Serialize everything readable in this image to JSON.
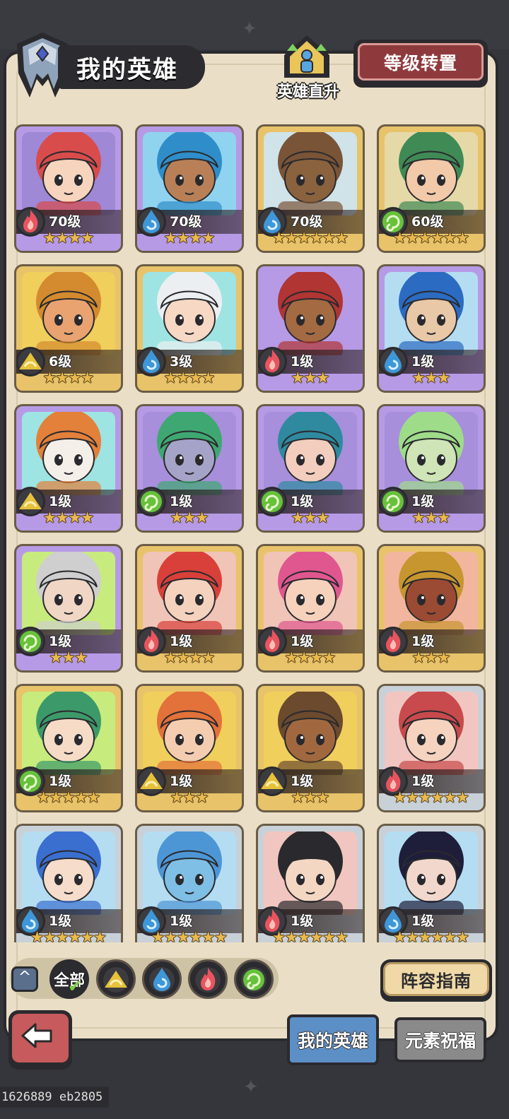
{
  "header": {
    "title": "我的英雄",
    "rise_label": "英雄直升",
    "transfer_button": "等级转置"
  },
  "colors": {
    "fire": "#e9545f",
    "water": "#3e97d8",
    "wind": "#67c23a",
    "earth": "#e6c23b",
    "card_purple": "#b79ae6",
    "card_gold": "#e8c36a",
    "card_silver": "#c9d1d8"
  },
  "heroes": [
    {
      "level": "70级",
      "element": "fire",
      "stars": 4,
      "frame": "purple",
      "hair": "#d84c4c",
      "skin": "#f6d4bd",
      "bg": "#9f88d6"
    },
    {
      "level": "70级",
      "element": "water",
      "stars": 4,
      "frame": "purple",
      "hair": "#2f8ec9",
      "skin": "#b98058",
      "bg": "#8fd3ef"
    },
    {
      "level": "70级",
      "element": "water",
      "stars": 6,
      "frame": "gold",
      "hair": "#7a5436",
      "skin": "#8a623e",
      "bg": "#cfe3e9"
    },
    {
      "level": "60级",
      "element": "wind",
      "stars": 6,
      "frame": "gold",
      "hair": "#3f8a55",
      "skin": "#f2c9a9",
      "bg": "#e6d9a8"
    },
    {
      "level": "6级",
      "element": "earth",
      "stars": 4,
      "frame": "gold",
      "hair": "#d48a2e",
      "skin": "#e8a370",
      "bg": "#f0cf5c"
    },
    {
      "level": "3级",
      "element": "water",
      "stars": 4,
      "frame": "gold",
      "hair": "#eceff1",
      "skin": "#f6d8c4",
      "bg": "#9ee4e3"
    },
    {
      "level": "1级",
      "element": "fire",
      "stars": 3,
      "frame": "purple",
      "hair": "#b03533",
      "skin": "#a46a42",
      "bg": "#b79ae6"
    },
    {
      "level": "1级",
      "element": "water",
      "stars": 3,
      "frame": "purple",
      "hair": "#2b6bc2",
      "skin": "#e8c8a6",
      "bg": "#b5ddf2"
    },
    {
      "level": "1级",
      "element": "earth",
      "stars": 4,
      "frame": "purple",
      "hair": "#e3803a",
      "skin": "#f4efe8",
      "bg": "#9ee4e3"
    },
    {
      "level": "1级",
      "element": "wind",
      "stars": 3,
      "frame": "purple",
      "hair": "#3fa872",
      "skin": "#a5a3c8",
      "bg": "#a78fdc"
    },
    {
      "level": "1级",
      "element": "wind",
      "stars": 3,
      "frame": "purple",
      "hair": "#2f8aa0",
      "skin": "#f3cdbd",
      "bg": "#a78fdc"
    },
    {
      "level": "1级",
      "element": "wind",
      "stars": 3,
      "frame": "purple",
      "hair": "#9fdc8a",
      "skin": "#cfe4b7",
      "bg": "#a78fdc"
    },
    {
      "level": "1级",
      "element": "wind",
      "stars": 3,
      "frame": "purple",
      "hair": "#cfcfcf",
      "skin": "#f0d6c4",
      "bg": "#c7ec7d"
    },
    {
      "level": "1级",
      "element": "fire",
      "stars": 4,
      "frame": "gold",
      "hair": "#d84039",
      "skin": "#f4d2bd",
      "bg": "#f1c4b8"
    },
    {
      "level": "1级",
      "element": "fire",
      "stars": 4,
      "frame": "gold",
      "hair": "#e0578f",
      "skin": "#f6d2bd",
      "bg": "#f1c4b8"
    },
    {
      "level": "1级",
      "element": "fire",
      "stars": 3,
      "frame": "gold",
      "hair": "#c7962f",
      "skin": "#9b4b33",
      "bg": "#f2b69f"
    },
    {
      "level": "1级",
      "element": "wind",
      "stars": 5,
      "frame": "gold",
      "hair": "#3c9a6a",
      "skin": "#f6dcc6",
      "bg": "#c7ec7d"
    },
    {
      "level": "1级",
      "element": "earth",
      "stars": 3,
      "frame": "gold",
      "hair": "#e3713a",
      "skin": "#f4cdb1",
      "bg": "#f0cf5c"
    },
    {
      "level": "1级",
      "element": "earth",
      "stars": 3,
      "frame": "gold",
      "hair": "#6b4a2e",
      "skin": "#a1683f",
      "bg": "#f0cf5c"
    },
    {
      "level": "1级",
      "element": "fire",
      "stars": 6,
      "frame": "silver",
      "hair": "#c84a4c",
      "skin": "#f6d3bf",
      "bg": "#f2c6c0"
    },
    {
      "level": "1级",
      "element": "water",
      "stars": 6,
      "frame": "silver",
      "hair": "#3a6fd0",
      "skin": "#f6dcca",
      "bg": "#b5ddf2"
    },
    {
      "level": "1级",
      "element": "water",
      "stars": 6,
      "frame": "silver",
      "hair": "#4d96d6",
      "skin": "#7fbfe6",
      "bg": "#b5ddf2"
    },
    {
      "level": "1级",
      "element": "fire",
      "stars": 6,
      "frame": "silver",
      "hair": "#2a2a2e",
      "skin": "#f4d7c3",
      "bg": "#f2c6c0"
    },
    {
      "level": "1级",
      "element": "water",
      "stars": 6,
      "frame": "silver",
      "hair": "#1e1e3a",
      "skin": "#f2d8cc",
      "bg": "#b5ddf2"
    }
  ],
  "filters": {
    "all_label": "全部",
    "elements": [
      "earth",
      "water",
      "fire",
      "wind"
    ]
  },
  "guide_button": "阵容指南",
  "tabs": {
    "my_heroes": "我的英雄",
    "blessing": "元素祝福"
  },
  "footer_id": "1626889 eb2805"
}
